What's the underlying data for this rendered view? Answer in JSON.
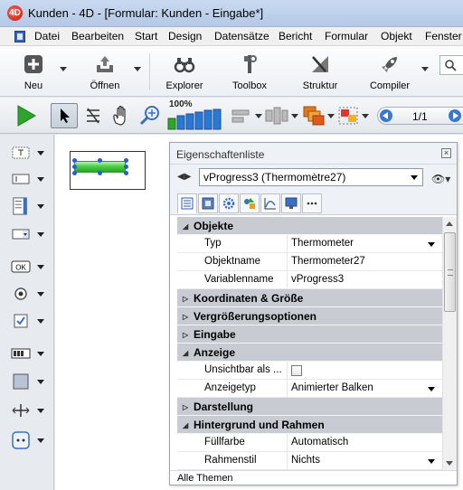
{
  "window": {
    "title": "Kunden - 4D - [Formular: Kunden -  Eingabe*]",
    "app_icon": "4D"
  },
  "menu": {
    "items": [
      "Datei",
      "Bearbeiten",
      "Start",
      "Design",
      "Datensätze",
      "Bericht",
      "Formular",
      "Objekt",
      "Fenster"
    ]
  },
  "toolbar": {
    "buttons": [
      {
        "label": "Neu",
        "icon": "plus-icon"
      },
      {
        "label": "Öffnen",
        "icon": "open-tray-icon"
      },
      {
        "label": "Explorer",
        "icon": "binoculars-icon"
      },
      {
        "label": "Toolbox",
        "icon": "tools-icon"
      },
      {
        "label": "Struktur",
        "icon": "structure-icon"
      },
      {
        "label": "Compiler",
        "icon": "rocket-icon"
      }
    ]
  },
  "form_toolbar": {
    "zoom_label": "100%",
    "page_indicator": "1/1"
  },
  "properties": {
    "title": "Eigenschaftenliste",
    "close": "×",
    "selected_object": "vProgress3 (Thermomètre27)",
    "tabs": [
      "all-properties-icon",
      "display-icon",
      "gear-icon",
      "shapes-icon",
      "chart-icon",
      "monitor-icon",
      "more-icon"
    ],
    "rows": [
      {
        "kind": "group",
        "expanded": true,
        "label": "Objekte"
      },
      {
        "kind": "prop",
        "name": "Typ",
        "value": "Thermometer",
        "dropdown": true
      },
      {
        "kind": "prop",
        "name": "Objektname",
        "value": "Thermometer27"
      },
      {
        "kind": "prop",
        "name": "Variablenname",
        "value": "vProgress3"
      },
      {
        "kind": "group",
        "expanded": false,
        "label": "Koordinaten & Größe"
      },
      {
        "kind": "group",
        "expanded": false,
        "label": "Vergrößerungsoptionen"
      },
      {
        "kind": "group",
        "expanded": false,
        "label": "Eingabe"
      },
      {
        "kind": "group",
        "expanded": true,
        "label": "Anzeige"
      },
      {
        "kind": "prop",
        "name": "Unsichtbar als ...",
        "value": "",
        "checkbox": true
      },
      {
        "kind": "prop",
        "name": "Anzeigetyp",
        "value": "Animierter Balken",
        "dropdown": true
      },
      {
        "kind": "group",
        "expanded": false,
        "label": "Darstellung"
      },
      {
        "kind": "group",
        "expanded": true,
        "label": "Hintergrund und Rahmen"
      },
      {
        "kind": "prop",
        "name": "Füllfarbe",
        "value": "Automatisch"
      },
      {
        "kind": "prop",
        "name": "Rahmenstil",
        "value": "Nichts",
        "dropdown": true
      }
    ],
    "footer": "Alle Themen"
  },
  "colors": {
    "accent": "#2b5ad8",
    "progress_green": "#4ccf48",
    "group_bg": "#c8ccd2"
  }
}
